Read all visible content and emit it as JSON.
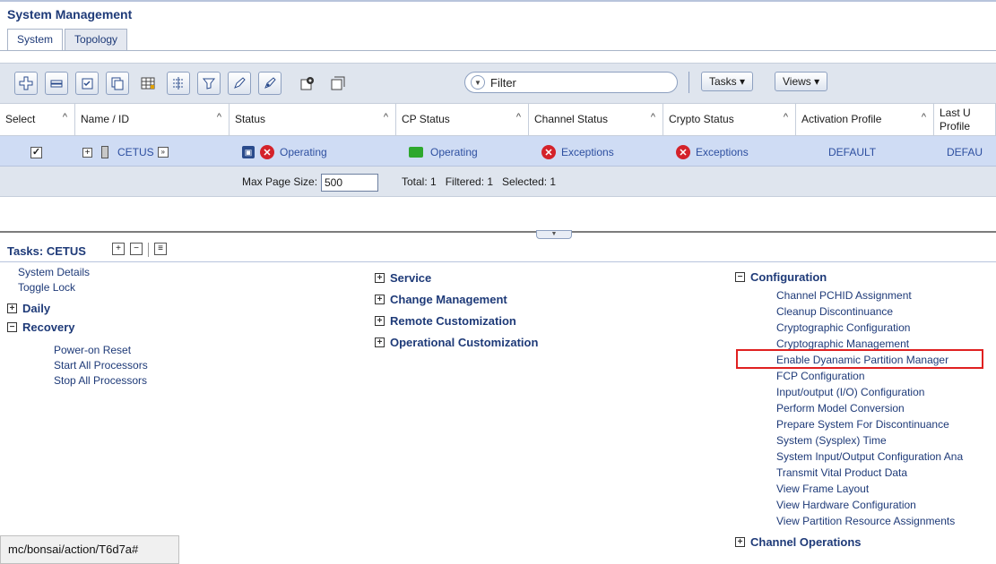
{
  "app": {
    "title": "System Management"
  },
  "tabs": [
    {
      "label": "System",
      "active": true
    },
    {
      "label": "Topology",
      "active": false
    }
  ],
  "toolbar": {
    "filter_placeholder": "Filter",
    "tasks_label": "Tasks ▾",
    "views_label": "Views ▾",
    "icons": [
      "add-icon",
      "remove-icon",
      "select-all-icon",
      "copy-icon",
      "table-icon",
      "columns-icon",
      "filter-icon",
      "edit-icon",
      "pen-icon",
      "config-icon",
      "details-icon"
    ]
  },
  "table": {
    "columns": [
      {
        "label": "Select"
      },
      {
        "label": "Name / ID"
      },
      {
        "label": "Status"
      },
      {
        "label": "CP Status"
      },
      {
        "label": "Channel Status"
      },
      {
        "label": "Crypto Status"
      },
      {
        "label": "Activation Profile"
      },
      {
        "label": "Last U Profile"
      }
    ],
    "row": {
      "selected": true,
      "name": "CETUS",
      "status": "Operating",
      "cp_status": "Operating",
      "channel_status": "Exceptions",
      "crypto_status": "Exceptions",
      "activation_profile": "DEFAULT",
      "last_profile": "DEFAU"
    },
    "footer": {
      "max_page_label": "Max Page Size:",
      "max_page_value": "500",
      "summary": "Total: 1   Filtered: 1   Selected: 1"
    }
  },
  "tasks": {
    "title": "Tasks: CETUS",
    "col1": {
      "items": [
        "System Details",
        "Toggle Lock"
      ],
      "groups": [
        {
          "label": "Daily",
          "expanded": false,
          "items": []
        },
        {
          "label": "Recovery",
          "expanded": true,
          "items": [
            "Power-on Reset",
            "Start All Processors",
            "Stop All Processors"
          ]
        }
      ]
    },
    "col2": {
      "groups": [
        "Service",
        "Change Management",
        "Remote Customization",
        "Operational Customization"
      ]
    },
    "col3": {
      "config_label": "Configuration",
      "config_items": [
        "Channel PCHID Assignment",
        "Cleanup Discontinuance",
        "Cryptographic Configuration",
        "Cryptographic Management",
        "Enable Dyanamic Partition Manager",
        "FCP Configuration",
        "Input/output (I/O) Configuration",
        "Perform Model Conversion",
        "Prepare System For Discontinuance",
        "System (Sysplex) Time",
        "System Input/Output Configuration Ana",
        "Transmit Vital Product Data",
        "View Frame Layout",
        "View Hardware Configuration",
        "View Partition Resource Assignments"
      ],
      "channel_ops_label": "Channel Operations"
    }
  },
  "status_bar": {
    "url": "mc/bonsai/action/T6d7a#"
  }
}
